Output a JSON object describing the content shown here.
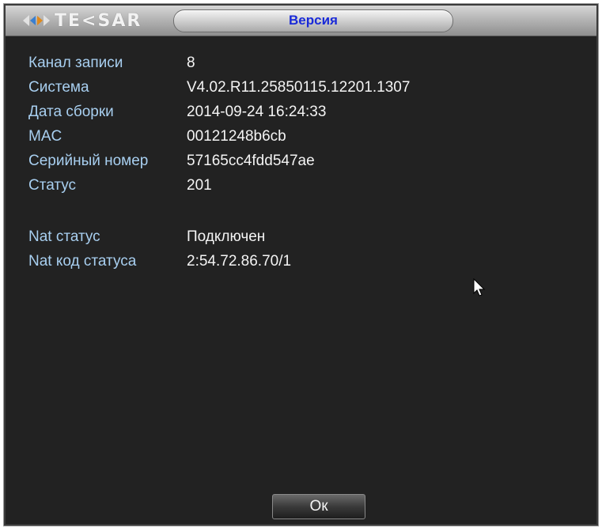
{
  "logo": {
    "text": "TE<SAR",
    "icon": "tecsar-logo-icon"
  },
  "window": {
    "title": "Версия"
  },
  "info": {
    "rows": [
      {
        "label": "Канал записи",
        "value": "8"
      },
      {
        "label": "Система",
        "value": "V4.02.R11.25850115.12201.1307"
      },
      {
        "label": "Дата сборки",
        "value": "2014-09-24 16:24:33"
      },
      {
        "label": "MAC",
        "value": "00121248b6cb"
      },
      {
        "label": "Серийный номер",
        "value": "57165cc4fdd547ae"
      },
      {
        "label": "Статус",
        "value": "201"
      },
      {
        "label": "Nat статус",
        "value": "Подключен"
      },
      {
        "label": "Nat код статуса",
        "value": "2:54.72.86.70/1"
      }
    ]
  },
  "buttons": {
    "ok_label": "Ок"
  },
  "colors": {
    "background": "#222222",
    "label": "#a8cff0",
    "value": "#f4f4f4",
    "title": "#1a2ad8"
  }
}
